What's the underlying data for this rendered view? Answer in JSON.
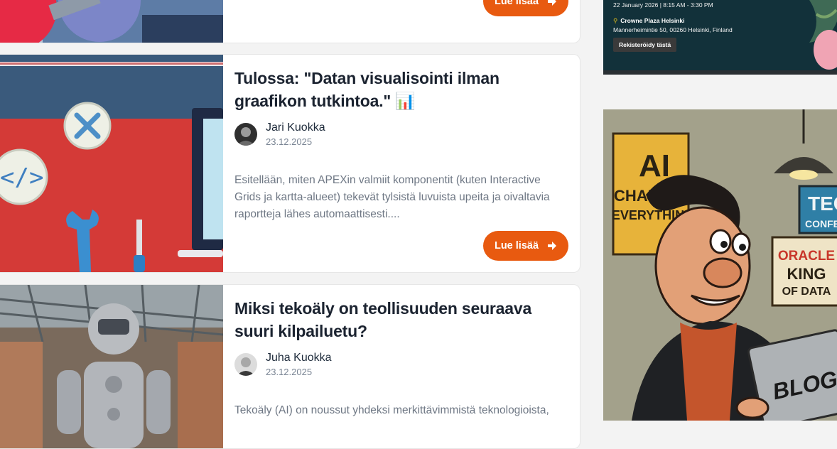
{
  "posts": [
    {
      "read_more_label": "Lue lisää"
    },
    {
      "title": "Tulossa: \"Datan visualisointi ilman graafikon tutkintoa.\" 📊",
      "author": "Jari Kuokka",
      "date": "23.12.2025",
      "excerpt": "Esitellään, miten APEXin valmiit komponentit (kuten Interactive Grids ja kartta-alueet) tekevät tylsistä luvuista upeita ja oivaltavia raportteja lähes automaattisesti....",
      "read_more_label": "Lue lisää"
    },
    {
      "title": "Miksi tekoäly on teollisuuden seuraava suuri kilpailuetu?",
      "author": "Juha Kuokka",
      "date": "23.12.2025",
      "excerpt": "Tekoäly (AI) on noussut yhdeksi merkittävimmistä teknologioista,"
    }
  ],
  "event_banner": {
    "date_text": "22 January 2026 | 8:15 AM - 3:30 PM",
    "venue": "Crowne Plaza Helsinki",
    "address": "Mannerheimintie 50, 00260 Helsinki, Finland",
    "register_label": "Rekisteröidy tästä"
  },
  "blog_banner": {
    "poster_line1": "AI",
    "poster_line2": "CHANGES",
    "poster_line3": "EVERYTHING",
    "tech_sign": "TEC",
    "tech_sign_sub": "CONFER",
    "oracle_sign_line1": "ORACLE",
    "oracle_sign_line2": "KING",
    "oracle_sign_line3": "OF DATA",
    "laptop_text": "BLOGS"
  },
  "colors": {
    "accent": "#e85a10",
    "title": "#1b2330",
    "muted": "#6e7784",
    "event_bg": "#12313a"
  }
}
